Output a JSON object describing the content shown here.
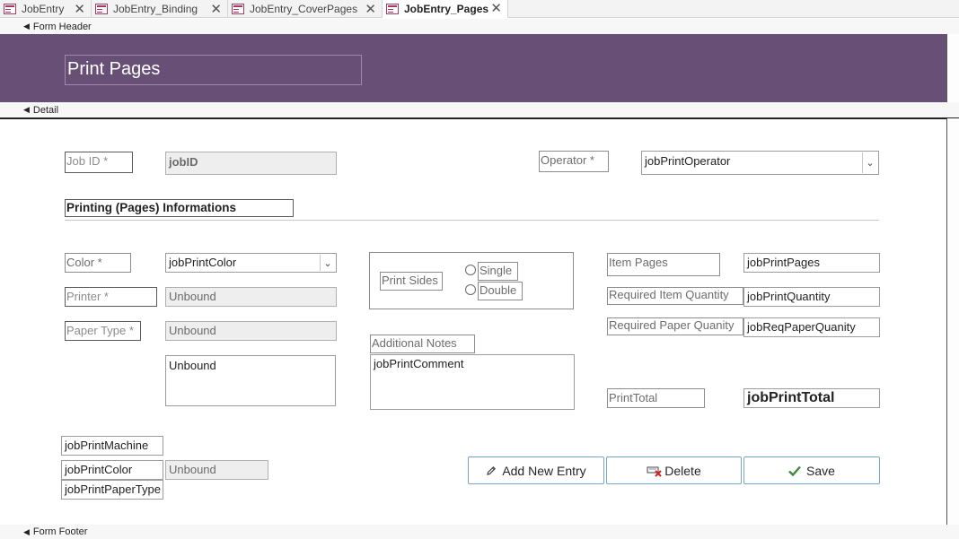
{
  "tabs": [
    {
      "label": "JobEntry",
      "active": false
    },
    {
      "label": "JobEntry_Binding",
      "active": false
    },
    {
      "label": "JobEntry_CoverPages",
      "active": false
    },
    {
      "label": "JobEntry_Pages",
      "active": true
    }
  ],
  "sections": {
    "form_header": "Form Header",
    "detail": "Detail",
    "form_footer": "Form Footer"
  },
  "header": {
    "title": "Print Pages",
    "band_color": "#684f75"
  },
  "fields": {
    "job_id_label": "Job ID *",
    "job_id_value": "jobID",
    "operator_label": "Operator *",
    "operator_value": "jobPrintOperator",
    "section_title": "Printing (Pages) Informations",
    "color_label": "Color *",
    "color_value": "jobPrintColor",
    "printer_label": "Printer *",
    "printer_value": "Unbound",
    "paper_type_label": "Paper Type *",
    "paper_type_value": "Unbound",
    "unbound_box_value": "Unbound",
    "print_sides_label": "Print Sides",
    "single_label": "Single",
    "double_label": "Double",
    "additional_notes_label": "Additional Notes",
    "comment_value": "jobPrintComment",
    "item_pages_label": "Item Pages",
    "item_pages_value": "jobPrintPages",
    "req_item_qty_label": "Required Item Quantity",
    "req_item_qty_value": "jobPrintQuantity",
    "req_paper_qty_label": "Required Paper Quanity",
    "req_paper_qty_value": "jobReqPaperQuanity",
    "print_total_label": "PrintTotal",
    "print_total_value": "jobPrintTotal",
    "machine_value": "jobPrintMachine",
    "hidden_color_value": "jobPrintColor",
    "hidden_unbound_value": "Unbound",
    "hidden_paper_type_value": "jobPrintPaperType"
  },
  "buttons": {
    "add_new_entry": "Add New Entry",
    "delete": "Delete",
    "save": "Save"
  },
  "icons": {
    "tab": "form-icon",
    "close": "close-icon",
    "section": "section-marker-icon",
    "dropdown": "chevron-down-icon",
    "add": "pencil-icon",
    "delete": "delete-icon",
    "save": "checkmark-icon"
  }
}
